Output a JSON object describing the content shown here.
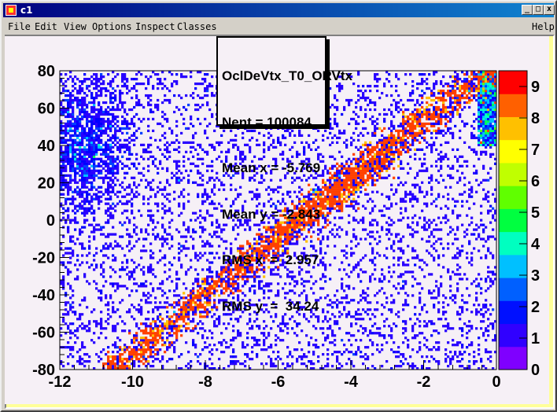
{
  "window": {
    "title": "c1",
    "controls": [
      "_",
      "□",
      "x"
    ]
  },
  "menu": {
    "items": [
      {
        "label": "File",
        "accel": "F"
      },
      {
        "label": "Edit",
        "accel": "E"
      },
      {
        "label": "View",
        "accel": "V"
      },
      {
        "label": "Options",
        "accel": "O"
      },
      {
        "label": "Inspect",
        "accel": "I"
      },
      {
        "label": "Classes",
        "accel": "C"
      }
    ],
    "help": "Help"
  },
  "stats": {
    "name": "OclDeVtx_T0_ORVtx",
    "nent": "Nent = 100084",
    "mean_x": "Mean x = -5.769",
    "mean_y": "Mean y = -2.843",
    "rms_x": "RMS x  =  2.957",
    "rms_y": "RMS y  =  34.24"
  },
  "chart_data": {
    "type": "heatmap",
    "title": "",
    "xlabel": "",
    "ylabel": "",
    "xlim": [
      -12,
      0
    ],
    "ylim": [
      -80,
      80
    ],
    "x_ticks": [
      "-12",
      "-10",
      "-8",
      "-6",
      "-4",
      "-2",
      "0"
    ],
    "y_ticks": [
      "80",
      "60",
      "40",
      "20",
      "0",
      "-20",
      "-40",
      "-60",
      "-80"
    ],
    "z_ticks": [
      "0",
      "1",
      "2",
      "3",
      "4",
      "5",
      "6",
      "7",
      "8",
      "9"
    ],
    "zlim": [
      0,
      9.5
    ],
    "entries": 100084,
    "mean_x": -5.769,
    "mean_y": -2.843,
    "rms_x": 2.957,
    "rms_y": 34.24,
    "band": {
      "description_points": [
        [
          -10.5,
          -80
        ],
        [
          -8,
          -42
        ],
        [
          -6,
          -12
        ],
        [
          -4,
          14
        ],
        [
          -2,
          45
        ],
        [
          0,
          68
        ]
      ],
      "peak_region": [
        [
          -5,
          -3.5
        ],
        [
          5,
          20
        ]
      ]
    },
    "colorbar_colors": [
      "#7f00ff",
      "#3000ff",
      "#0010ff",
      "#0060ff",
      "#00c0ff",
      "#00ffc0",
      "#00ff40",
      "#60ff00",
      "#c0ff00",
      "#ffff00",
      "#ffc000",
      "#ff6000",
      "#ff0000"
    ]
  }
}
